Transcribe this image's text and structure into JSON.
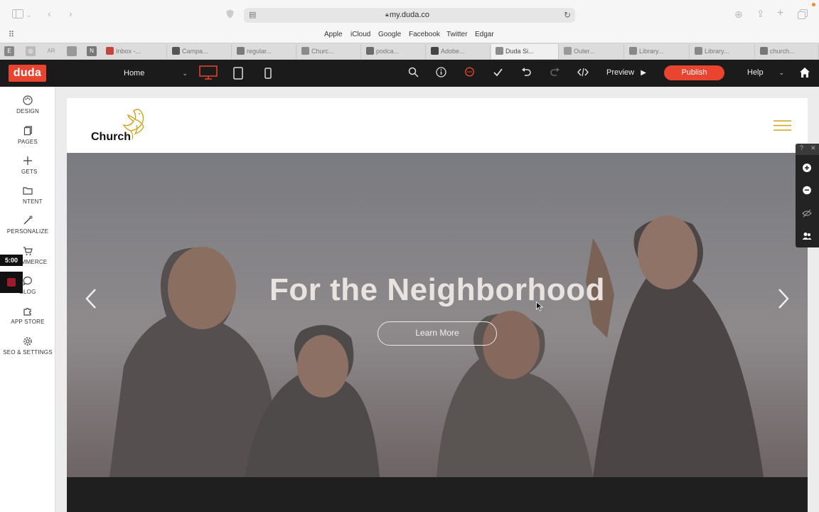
{
  "browser": {
    "url": "my.duda.co",
    "favorites": [
      "Apple",
      "iCloud",
      "Google",
      "Facebook",
      "Twitter",
      "Edgar"
    ],
    "pinned": [
      "E",
      "AR"
    ],
    "tabs": [
      {
        "label": "Inbox -...",
        "color": "#c4453c"
      },
      {
        "label": "Campa...",
        "color": "#555555"
      },
      {
        "label": "regular...",
        "color": "#7a7a7a"
      },
      {
        "label": "Churc...",
        "color": "#8a8a8a"
      },
      {
        "label": "podca...",
        "color": "#6b6b6b"
      },
      {
        "label": "Adobe...",
        "color": "#444444"
      },
      {
        "label": "Duda Si...",
        "color": "#8a8a8a"
      },
      {
        "label": "Outer...",
        "color": "#999999"
      },
      {
        "label": "Library...",
        "color": "#888888"
      },
      {
        "label": "Library...",
        "color": "#888888"
      },
      {
        "label": "church...",
        "color": "#777777"
      }
    ]
  },
  "duda_bar": {
    "logo": "duda",
    "page_select": "Home",
    "preview_label": "Preview",
    "publish_label": "Publish",
    "help_label": "Help",
    "accent": "#e8442f"
  },
  "sidebar": {
    "items": [
      {
        "label": "DESIGN",
        "icon": "palette-icon"
      },
      {
        "label": "PAGES",
        "icon": "pages-icon"
      },
      {
        "label": "GETS",
        "icon": "plus-icon"
      },
      {
        "label": "NTENT",
        "icon": "folder-icon"
      },
      {
        "label": "PERSONALIZE",
        "icon": "wand-icon"
      },
      {
        "label": "ECOMMERCE",
        "icon": "cart-icon"
      },
      {
        "label": "BLOG",
        "icon": "chat-bubble-icon"
      },
      {
        "label": "APP STORE",
        "icon": "puzzle-icon"
      },
      {
        "label": "SEO & SETTINGS",
        "icon": "gear-icon"
      }
    ],
    "timer": "5:00"
  },
  "site": {
    "logo_text": "Church",
    "hero_headline": "For the Neighborhood",
    "hero_button": "Learn More",
    "brand_gold": "#d4a017"
  }
}
